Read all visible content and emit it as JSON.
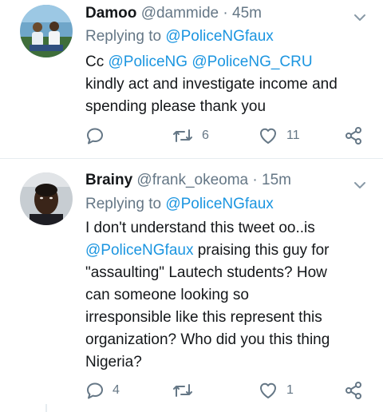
{
  "tweets": [
    {
      "name": "Damoo",
      "handle": "@dammide",
      "separator": "·",
      "time": "45m",
      "replying_prefix": "Replying to",
      "replying_handle": "@PoliceNGfaux",
      "body_lines": [
        [
          {
            "t": "Cc ",
            "m": false
          },
          {
            "t": "@PoliceNG",
            "m": true
          },
          {
            "t": " ",
            "m": false
          },
          {
            "t": "@PoliceNG_CRU",
            "m": true
          }
        ],
        [
          {
            "t": "kindly act and investigate income and",
            "m": false
          }
        ],
        [
          {
            "t": "spending please thank you",
            "m": false
          }
        ]
      ],
      "reply_count": "",
      "retweet_count": "6",
      "like_count": "11",
      "icons": {
        "reply": "reply-icon",
        "retweet": "retweet-icon",
        "like": "heart-icon",
        "share": "share-icon",
        "caret": "chevron-down-icon"
      }
    },
    {
      "name": "Brainy",
      "handle": "@frank_okeoma",
      "separator": "·",
      "time": "15m",
      "replying_prefix": "Replying to",
      "replying_handle": "@PoliceNGfaux",
      "body_lines": [
        [
          {
            "t": "I don't understand this tweet oo..is",
            "m": false
          }
        ],
        [
          {
            "t": "@PoliceNGfaux",
            "m": true
          },
          {
            "t": " praising this guy for",
            "m": false
          }
        ],
        [
          {
            "t": "\"assaulting\" Lautech students? How",
            "m": false
          }
        ],
        [
          {
            "t": "can someone looking so",
            "m": false
          }
        ],
        [
          {
            "t": "irresponsible like this represent this",
            "m": false
          }
        ],
        [
          {
            "t": "organization? Who did you this thing",
            "m": false
          }
        ],
        [
          {
            "t": "Nigeria?",
            "m": false
          }
        ]
      ],
      "reply_count": "4",
      "retweet_count": "",
      "like_count": "1",
      "icons": {
        "reply": "reply-icon",
        "retweet": "retweet-icon",
        "like": "heart-icon",
        "share": "share-icon",
        "caret": "chevron-down-icon"
      }
    }
  ],
  "colors": {
    "text": "#14171a",
    "secondary": "#657786",
    "link": "#1b95e0",
    "divider": "#e6ecf0"
  }
}
